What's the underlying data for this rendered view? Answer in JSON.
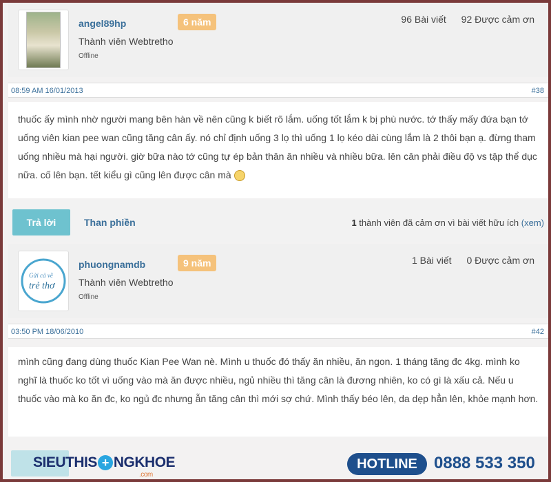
{
  "posts": [
    {
      "username": "angel89hp",
      "years": "6 năm",
      "role": "Thành viên Webtretho",
      "status": "Offline",
      "post_count": "96 Bài viết",
      "thanks_count": "92 Được cảm ơn",
      "date": "08:59 AM 16/01/2013",
      "post_number": "#38",
      "content": "thuốc ấy mình nhờ người mang bên hàn về nên cũng k biết rõ lắm. uống tốt lắm k bị phù nước. tớ thấy mấy đứa bạn tớ uống viên kian pee wan cũng tăng cân ấy. nó chỉ định uống 3 lọ thì uống 1 lọ kéo dài cùng lắm là 2 thôi bạn ạ. đừng tham uống nhiều mà hại người. giờ bữa nào tớ cũng tự ép bản thân ăn nhiều và nhiều bữa. lên cân phải điều độ vs tập thể dục nữa. cố lên bạn. tết kiểu gì cũng lên được cân mà",
      "avatar_icon": "user-photo-icon"
    },
    {
      "username": "phuongnamdb",
      "years": "9 năm",
      "role": "Thành viên Webtretho",
      "status": "Offline",
      "post_count": "1 Bài viết",
      "thanks_count": "0 Được cảm ơn",
      "date": "03:50 PM 18/06/2010",
      "post_number": "#42",
      "content": "mình cũng đang dùng thuốc Kian Pee Wan nè. Mình u thuốc đó thấy ăn nhiều, ăn ngon. 1 tháng tăng đc 4kg. mình ko nghĩ là thuốc ko tốt vì uống vào mà ăn được nhiều, ngủ nhiều thì tăng cân là đương nhiên, ko có gì là xấu cả. Nếu u thuốc vào mà ko ăn đc, ko ngủ đc nhưng ẫn tăng cân thì mới sợ chứ. Mình thấy béo lên, da dẹp hẳn lên, khỏe mạnh hơn.",
      "avatar_logo_text": [
        "Gửi cả về",
        "trẻ thơ"
      ]
    }
  ],
  "actions": {
    "reply_label": "Trả lời",
    "complain_label": "Than phiền",
    "thanks_count": "1",
    "thanks_text": "thành viên đã cảm ơn vì bài viết hữu ích",
    "see_label": "(xem)"
  },
  "footer": {
    "logo_part1": "SIEUTHIS",
    "logo_plus": "+",
    "logo_part2": "NGKHOE",
    "logo_dotcom": ".com",
    "hotline_label": "HOTLINE",
    "hotline_number": "0888 533 350"
  },
  "colors": {
    "accent": "#3a6f9a",
    "badge": "#f5c27b",
    "reply_button": "#6ec2cf",
    "hotline": "#1e4f8c",
    "frame": "#7a3a3a"
  }
}
